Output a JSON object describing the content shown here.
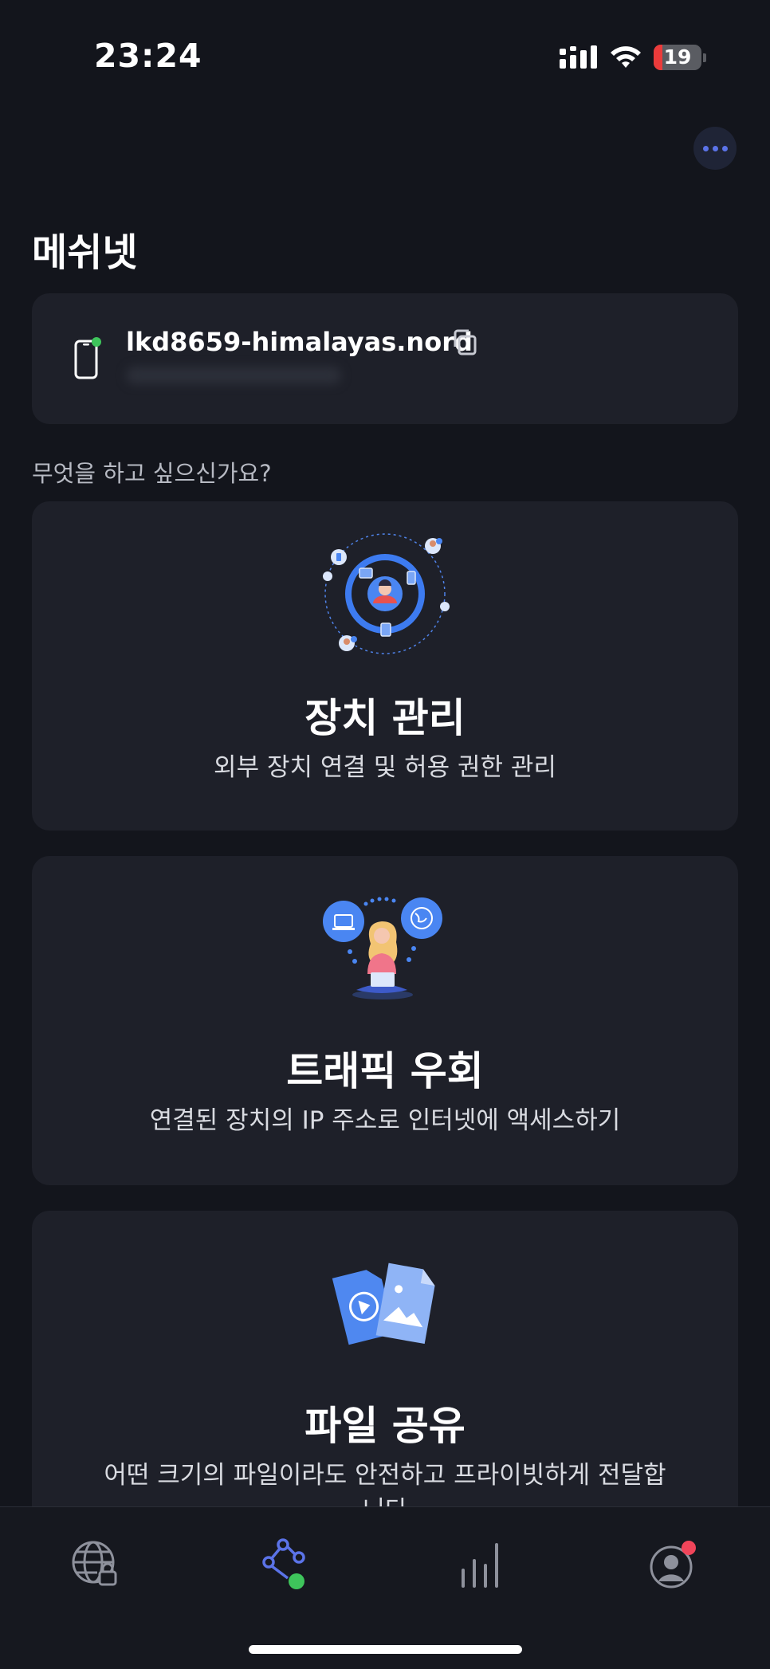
{
  "status_bar": {
    "time": "23:24",
    "battery_level": "19",
    "battery_fraction": 0.19
  },
  "header": {
    "title": "메쉬넷",
    "more_icon": "more-horizontal-icon"
  },
  "device": {
    "name": "lkd8659-himalayas.nord",
    "icon": "smartphone-icon",
    "status_color": "#3ec45b",
    "copy_icon": "copy-icon"
  },
  "section_label": "무엇을 하고 싶으신가요?",
  "features": [
    {
      "title": "장치 관리",
      "description": "외부 장치 연결 및 허용 권한 관리",
      "illustration": "device-network-illustration"
    },
    {
      "title": "트래픽 우회",
      "description": "연결된 장치의 IP 주소로 인터넷에 액세스하기",
      "illustration": "traffic-routing-illustration"
    },
    {
      "title": "파일 공유",
      "description": "어떤 크기의 파일이라도 안전하고 프라이빗하게 전달합니다",
      "illustration": "file-sharing-illustration"
    }
  ],
  "bottom_nav": {
    "tabs": [
      {
        "icon": "globe-lock-icon",
        "active": false
      },
      {
        "icon": "meshnet-icon",
        "active": true
      },
      {
        "icon": "stats-bars-icon",
        "active": false
      },
      {
        "icon": "profile-icon",
        "active": false,
        "badge": true
      }
    ],
    "accent": "#5b73e8",
    "badge_color": "#f0455a"
  }
}
